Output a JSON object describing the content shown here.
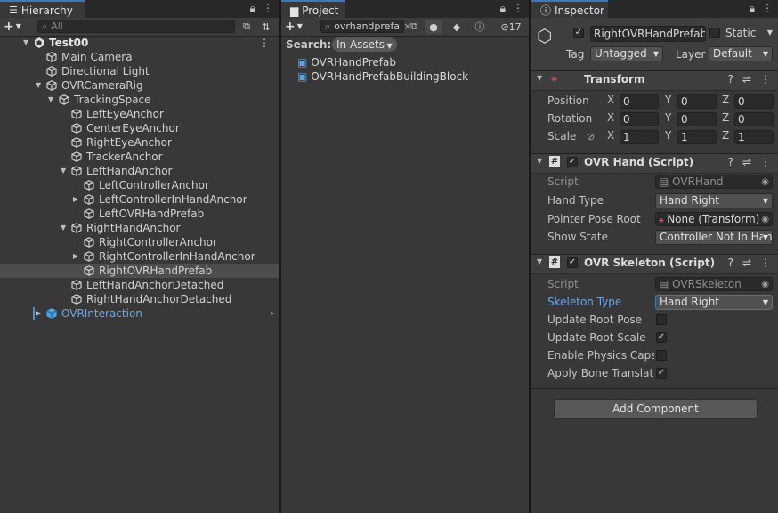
{
  "hierarchy": {
    "tab": "Hierarchy",
    "search_placeholder": "All",
    "items": [
      {
        "label": "Test00",
        "depth": 0,
        "arrow": "open",
        "icon": "unity",
        "style": "bold"
      },
      {
        "label": "Main Camera",
        "depth": 1,
        "arrow": "none"
      },
      {
        "label": "Directional Light",
        "depth": 1,
        "arrow": "none"
      },
      {
        "label": "OVRCameraRig",
        "depth": 1,
        "arrow": "open"
      },
      {
        "label": "TrackingSpace",
        "depth": 2,
        "arrow": "open"
      },
      {
        "label": "LeftEyeAnchor",
        "depth": 3,
        "arrow": "none"
      },
      {
        "label": "CenterEyeAnchor",
        "depth": 3,
        "arrow": "none"
      },
      {
        "label": "RightEyeAnchor",
        "depth": 3,
        "arrow": "none"
      },
      {
        "label": "TrackerAnchor",
        "depth": 3,
        "arrow": "none"
      },
      {
        "label": "LeftHandAnchor",
        "depth": 3,
        "arrow": "open"
      },
      {
        "label": "LeftControllerAnchor",
        "depth": 4,
        "arrow": "none"
      },
      {
        "label": "LeftControllerInHandAnchor",
        "depth": 4,
        "arrow": "closed"
      },
      {
        "label": "LeftOVRHandPrefab",
        "depth": 4,
        "arrow": "none"
      },
      {
        "label": "RightHandAnchor",
        "depth": 3,
        "arrow": "open"
      },
      {
        "label": "RightControllerAnchor",
        "depth": 4,
        "arrow": "none"
      },
      {
        "label": "RightControllerInHandAnchor",
        "depth": 4,
        "arrow": "closed"
      },
      {
        "label": "RightOVRHandPrefab",
        "depth": 4,
        "arrow": "none",
        "style": "selected"
      },
      {
        "label": "LeftHandAnchorDetached",
        "depth": 3,
        "arrow": "none"
      },
      {
        "label": "RightHandAnchorDetached",
        "depth": 3,
        "arrow": "none"
      },
      {
        "label": "OVRInteraction",
        "depth": 1,
        "arrow": "closed",
        "style": "blue"
      }
    ]
  },
  "project": {
    "tab": "Project",
    "search_value": "ovrhandprefa",
    "hidden_count": "17",
    "search_label": "Search:",
    "scope": "In Assets",
    "assets": [
      "OVRHandPrefab",
      "OVRHandPrefabBuildingBlock"
    ]
  },
  "inspector": {
    "tab": "Inspector",
    "object_name": "RightOVRHandPrefab",
    "static_label": "Static",
    "tag_label": "Tag",
    "tag_value": "Untagged",
    "layer_label": "Layer",
    "layer_value": "Default",
    "transform": {
      "title": "Transform",
      "position_label": "Position",
      "rotation_label": "Rotation",
      "scale_label": "Scale",
      "position": [
        "0",
        "0",
        "0"
      ],
      "rotation": [
        "0",
        "0",
        "0"
      ],
      "scale": [
        "1",
        "1",
        "1"
      ],
      "axes": [
        "X",
        "Y",
        "Z"
      ]
    },
    "ovr_hand": {
      "title": "OVR Hand (Script)",
      "script_label": "Script",
      "script_value": "OVRHand",
      "hand_type_label": "Hand Type",
      "hand_type_value": "Hand Right",
      "pointer_label": "Pointer Pose Root",
      "pointer_value": "None (Transform)",
      "show_state_label": "Show State",
      "show_state_value": "Controller Not In Hand"
    },
    "ovr_skeleton": {
      "title": "OVR Skeleton (Script)",
      "script_label": "Script",
      "script_value": "OVRSkeleton",
      "skeleton_type_label": "Skeleton Type",
      "skeleton_type_value": "Hand Right",
      "update_root_pose_label": "Update Root Pose",
      "update_root_pose": false,
      "update_root_scale_label": "Update Root Scale",
      "update_root_scale": true,
      "enable_physics_label": "Enable Physics Capsules",
      "enable_physics": false,
      "apply_bone_label": "Apply Bone Translations",
      "apply_bone": true
    },
    "add_component": "Add Component"
  }
}
